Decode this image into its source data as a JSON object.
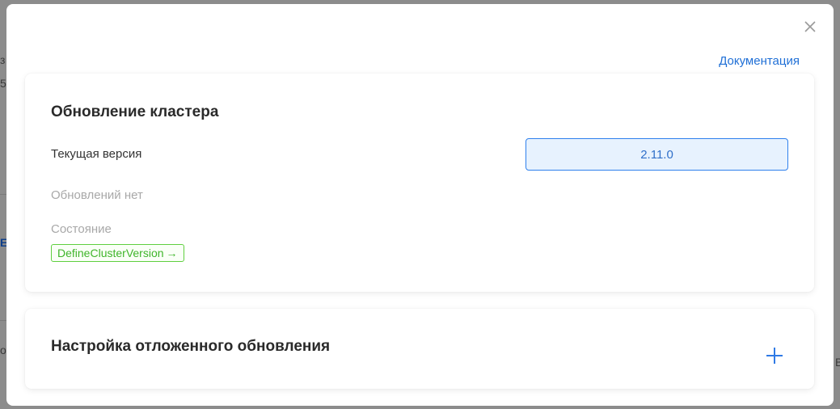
{
  "background": {
    "fragments": [
      "з",
      "5",
      "Е",
      "or",
      "В"
    ]
  },
  "modal": {
    "documentation_link": "Документация",
    "close_icon": "close-icon"
  },
  "update_card": {
    "title": "Обновление кластера",
    "current_version_label": "Текущая версия",
    "current_version": "2.11.0",
    "no_updates_text": "Обновлений нет",
    "state_label": "Состояние",
    "state_value": "DefineClusterVersion",
    "state_arrow": "→"
  },
  "deferred_card": {
    "title": "Настройка отложенного обновления",
    "add_icon": "plus-icon"
  },
  "colors": {
    "accent": "#2f80ed",
    "status_green": "#3fb52a",
    "overlay": "#8c8c8c"
  }
}
